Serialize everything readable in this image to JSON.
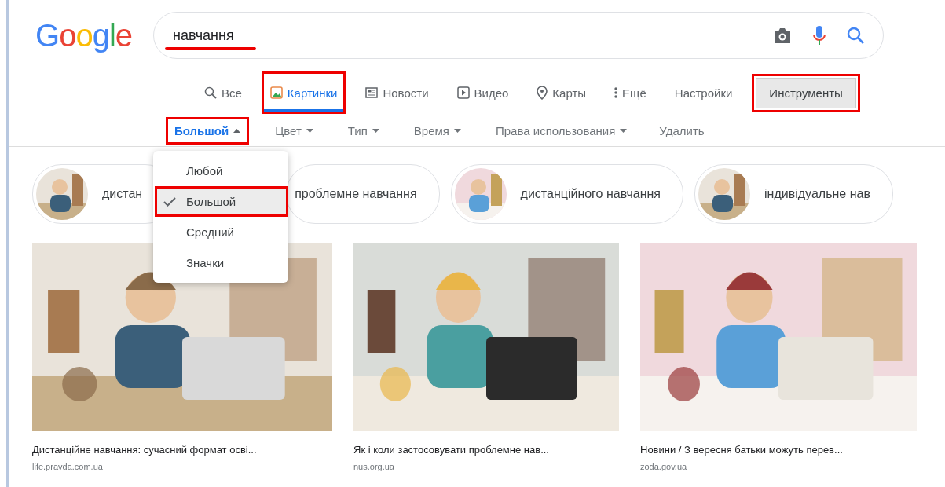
{
  "logo": "Google",
  "search": {
    "value": "навчання",
    "underlined": true
  },
  "tabs": [
    {
      "label": "Все",
      "selected": false,
      "highlighted": false
    },
    {
      "label": "Картинки",
      "selected": true,
      "highlighted": true
    },
    {
      "label": "Новости",
      "selected": false,
      "highlighted": false
    },
    {
      "label": "Видео",
      "selected": false,
      "highlighted": false
    },
    {
      "label": "Карты",
      "selected": false,
      "highlighted": false
    },
    {
      "label": "Ещё",
      "selected": false,
      "highlighted": false
    },
    {
      "label": "Настройки",
      "selected": false,
      "highlighted": false
    }
  ],
  "tools_button": {
    "label": "Инструменты",
    "highlighted": true
  },
  "filters": [
    {
      "label": "Большой",
      "active": true,
      "expanded": true,
      "highlighted": true
    },
    {
      "label": "Цвет",
      "active": false,
      "expanded": false,
      "highlighted": false
    },
    {
      "label": "Тип",
      "active": false,
      "expanded": false,
      "highlighted": false
    },
    {
      "label": "Время",
      "active": false,
      "expanded": false,
      "highlighted": false
    },
    {
      "label": "Права использования",
      "active": false,
      "expanded": false,
      "highlighted": false
    }
  ],
  "clear_link": "Удалить",
  "size_menu": [
    {
      "label": "Любой",
      "selected": false,
      "highlighted": false
    },
    {
      "label": "Большой",
      "selected": true,
      "highlighted": true
    },
    {
      "label": "Средний",
      "selected": false,
      "highlighted": false
    },
    {
      "label": "Значки",
      "selected": false,
      "highlighted": false
    }
  ],
  "chips": [
    {
      "label": "дистан",
      "kind": "thumb"
    },
    {
      "label": "проблемне навчання",
      "kind": "plain"
    },
    {
      "label": "дистанційного навчання",
      "kind": "thumb"
    },
    {
      "label": "індивідуальне нав",
      "kind": "thumb"
    }
  ],
  "results": [
    {
      "title": "Дистанційне навчання: сучасний формат осві...",
      "source": "life.pravda.com.ua"
    },
    {
      "title": "Як і коли застосовувати проблемне нав...",
      "source": "nus.org.ua"
    },
    {
      "title": "Новини / З вересня батьки можуть перев...",
      "source": "zoda.gov.ua"
    }
  ]
}
